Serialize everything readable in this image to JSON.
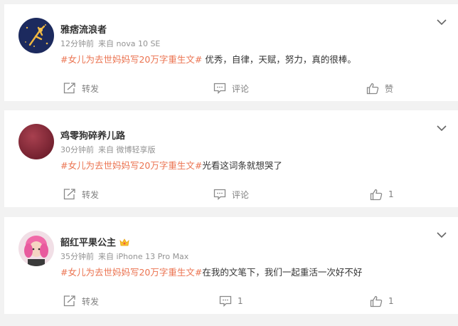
{
  "posts": [
    {
      "username": "雅痞流浪者",
      "time": "12分钟前",
      "source": "来自 nova 10 SE",
      "hashtag": "#女儿为去世妈妈写20万字重生文#",
      "text": " 优秀，自律，天赋，努力，真的很棒。",
      "share_label": "转发",
      "comment_label": "评论",
      "like_label": "赞"
    },
    {
      "username": "鸡零狗碎养儿路",
      "time": "30分钟前",
      "source": "来自 微博轻享版",
      "hashtag": "#女儿为去世妈妈写20万字重生文#",
      "text": "光看这词条就想哭了",
      "share_label": "转发",
      "comment_label": "评论",
      "like_label": "1"
    },
    {
      "username": "韶红平果公主",
      "time": "35分钟前",
      "source": "来自 iPhone 13 Pro Max",
      "hashtag": "#女儿为去世妈妈写20万字重生文#",
      "text": "在我的文笔下，我们一起重活一次好不好",
      "share_label": "转发",
      "comment_label": "1",
      "like_label": "1"
    }
  ],
  "colors": {
    "hashtag": "#eb7350",
    "meta": "#939393",
    "action": "#808080",
    "background": "#f2f2f2"
  },
  "icons": [
    "chevron-down-icon",
    "share-icon",
    "comment-icon",
    "like-icon",
    "crown-badge-icon"
  ]
}
